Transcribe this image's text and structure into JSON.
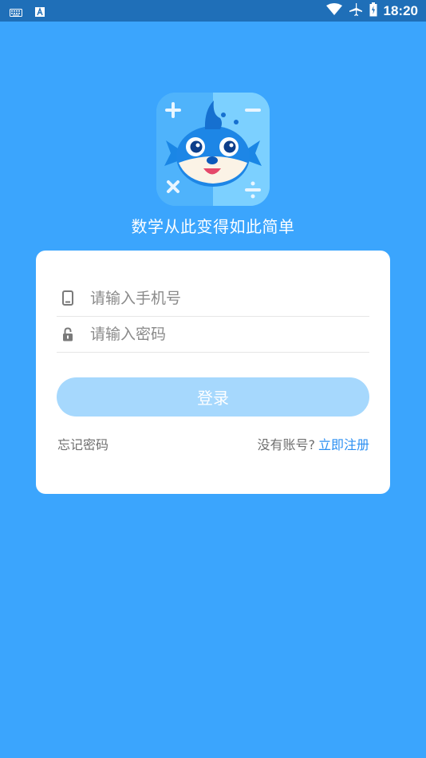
{
  "status_bar": {
    "time": "18:20",
    "icons": [
      "keyboard-icon",
      "a-notification-icon",
      "wifi-icon",
      "airplane-icon",
      "battery-icon"
    ],
    "color": "#1f6fb8"
  },
  "app": {
    "slogan": "数学从此变得如此简单",
    "logo_icon": "fish-math-logo",
    "background": "#3ba5fd"
  },
  "login_form": {
    "phone_placeholder": "请输入手机号",
    "password_placeholder": "请输入密码",
    "login_label": "登录",
    "forgot_label": "忘记密码",
    "no_account_label": "没有账号?",
    "register_label": "立即注册",
    "accent": "#2b8ff2",
    "button_color": "#a6d8fd"
  }
}
